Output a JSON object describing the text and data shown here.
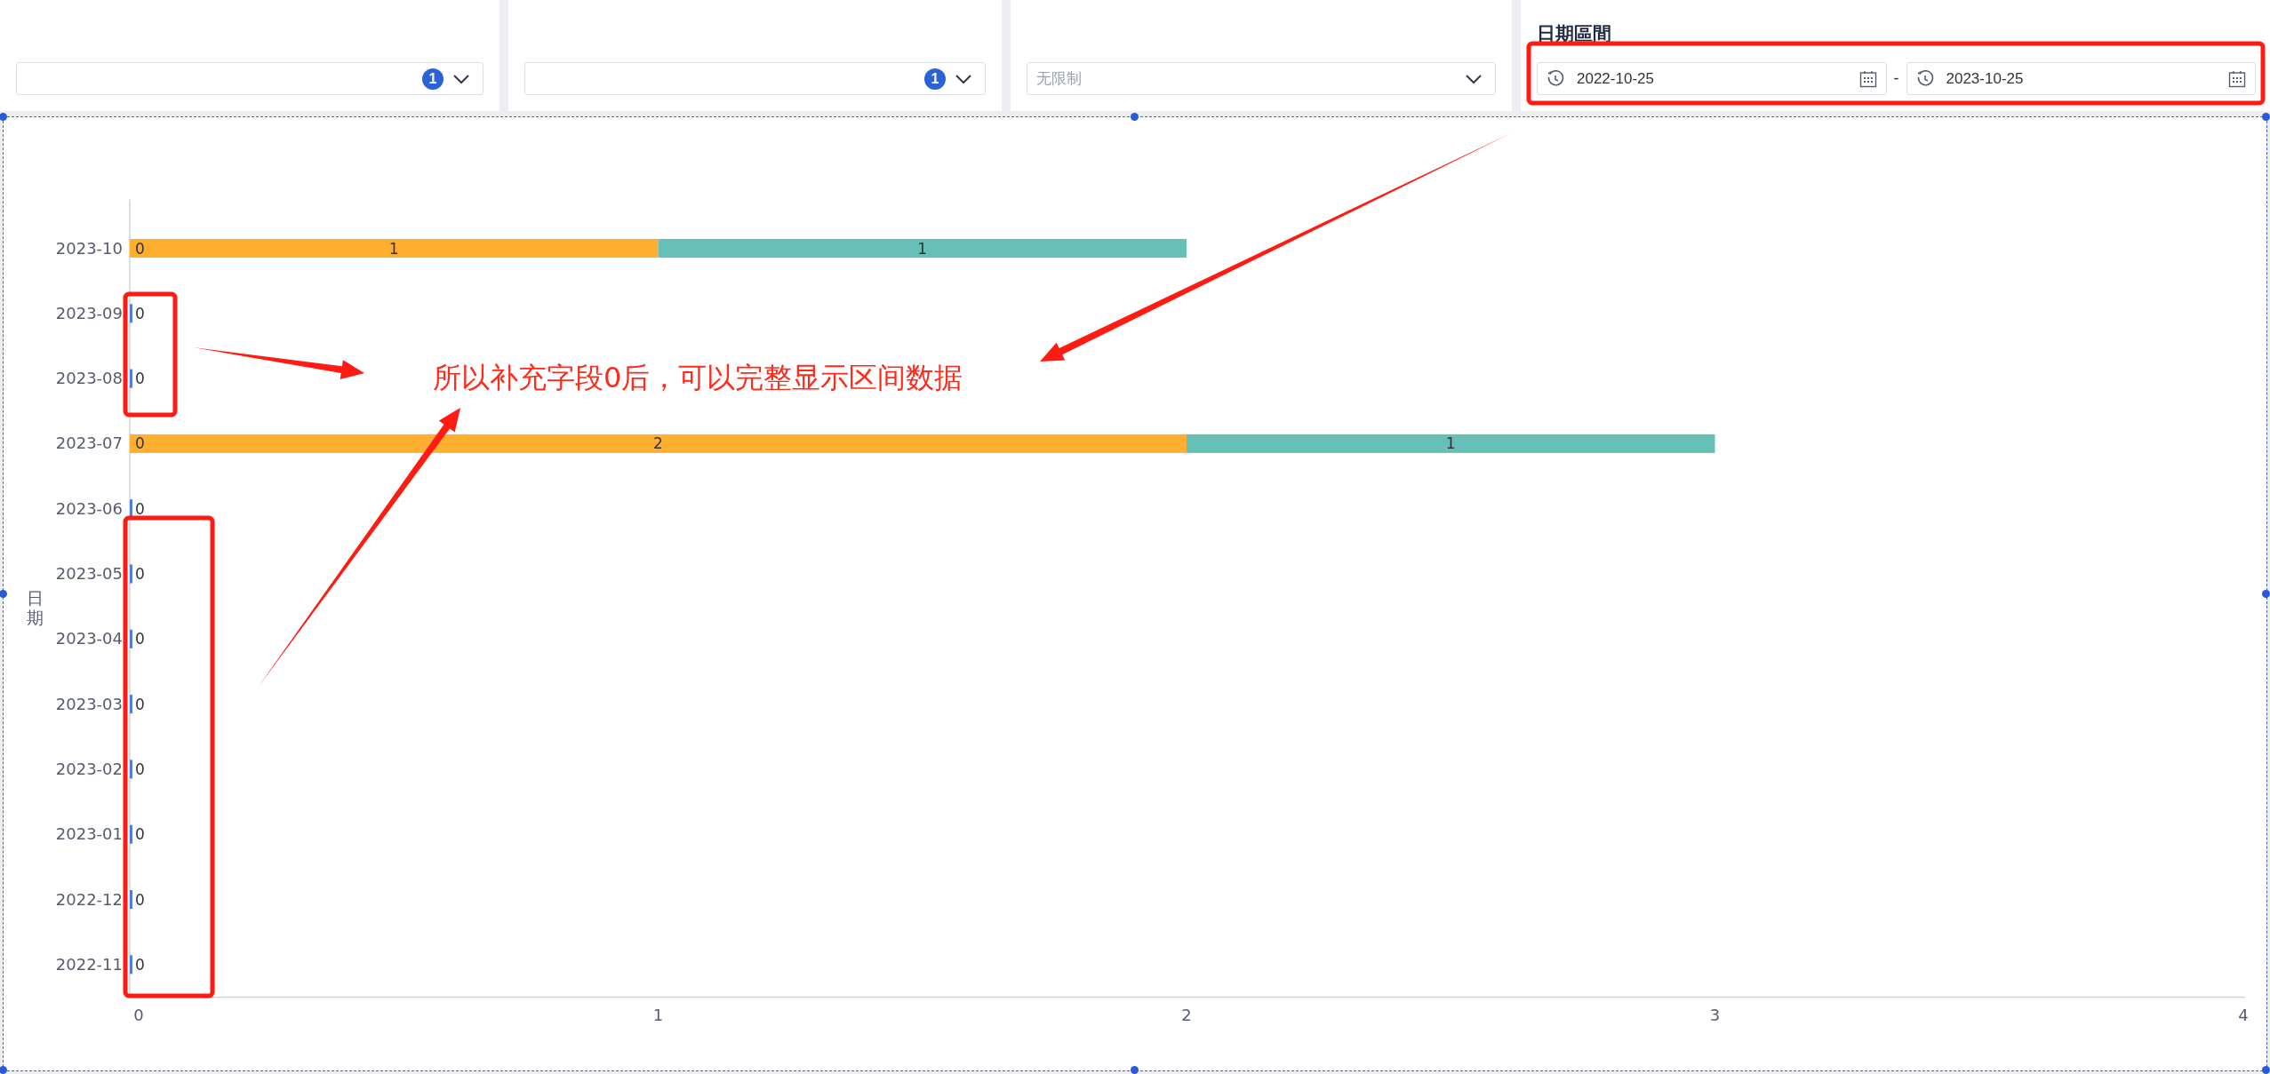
{
  "filters": [
    {
      "kind": "select",
      "badge": "1"
    },
    {
      "kind": "select",
      "badge": "1"
    },
    {
      "kind": "select",
      "placeholder": "无限制"
    }
  ],
  "date_range": {
    "title": "日期區間",
    "start": "2022-10-25",
    "separator": "-",
    "end": "2023-10-25"
  },
  "chart": {
    "selected": true,
    "chart_data": {
      "type": "bar",
      "orientation": "horizontal",
      "stacked": true,
      "ylabel": "日期",
      "data_labels": true,
      "categories": [
        "2023-10",
        "2023-09",
        "2023-08",
        "2023-07",
        "2023-06",
        "2023-05",
        "2023-04",
        "2023-03",
        "2023-02",
        "2023-01",
        "2022-12",
        "2022-11"
      ],
      "series": [
        {
          "color": "#4e7fe0",
          "values": [
            0,
            0,
            0,
            0,
            0,
            0,
            0,
            0,
            0,
            0,
            0,
            0
          ]
        },
        {
          "color": "#ffaf30",
          "values": [
            1,
            null,
            null,
            2,
            null,
            null,
            null,
            null,
            null,
            null,
            null,
            null
          ]
        },
        {
          "color": "#67c0b8",
          "values": [
            1,
            null,
            null,
            1,
            null,
            null,
            null,
            null,
            null,
            null,
            null,
            null
          ]
        }
      ],
      "xlim": [
        0,
        4
      ],
      "xticks": [
        0,
        1,
        2,
        3,
        4
      ]
    }
  },
  "annotation": {
    "text": "所以补充字段0后，可以完整显示区间数据"
  }
}
